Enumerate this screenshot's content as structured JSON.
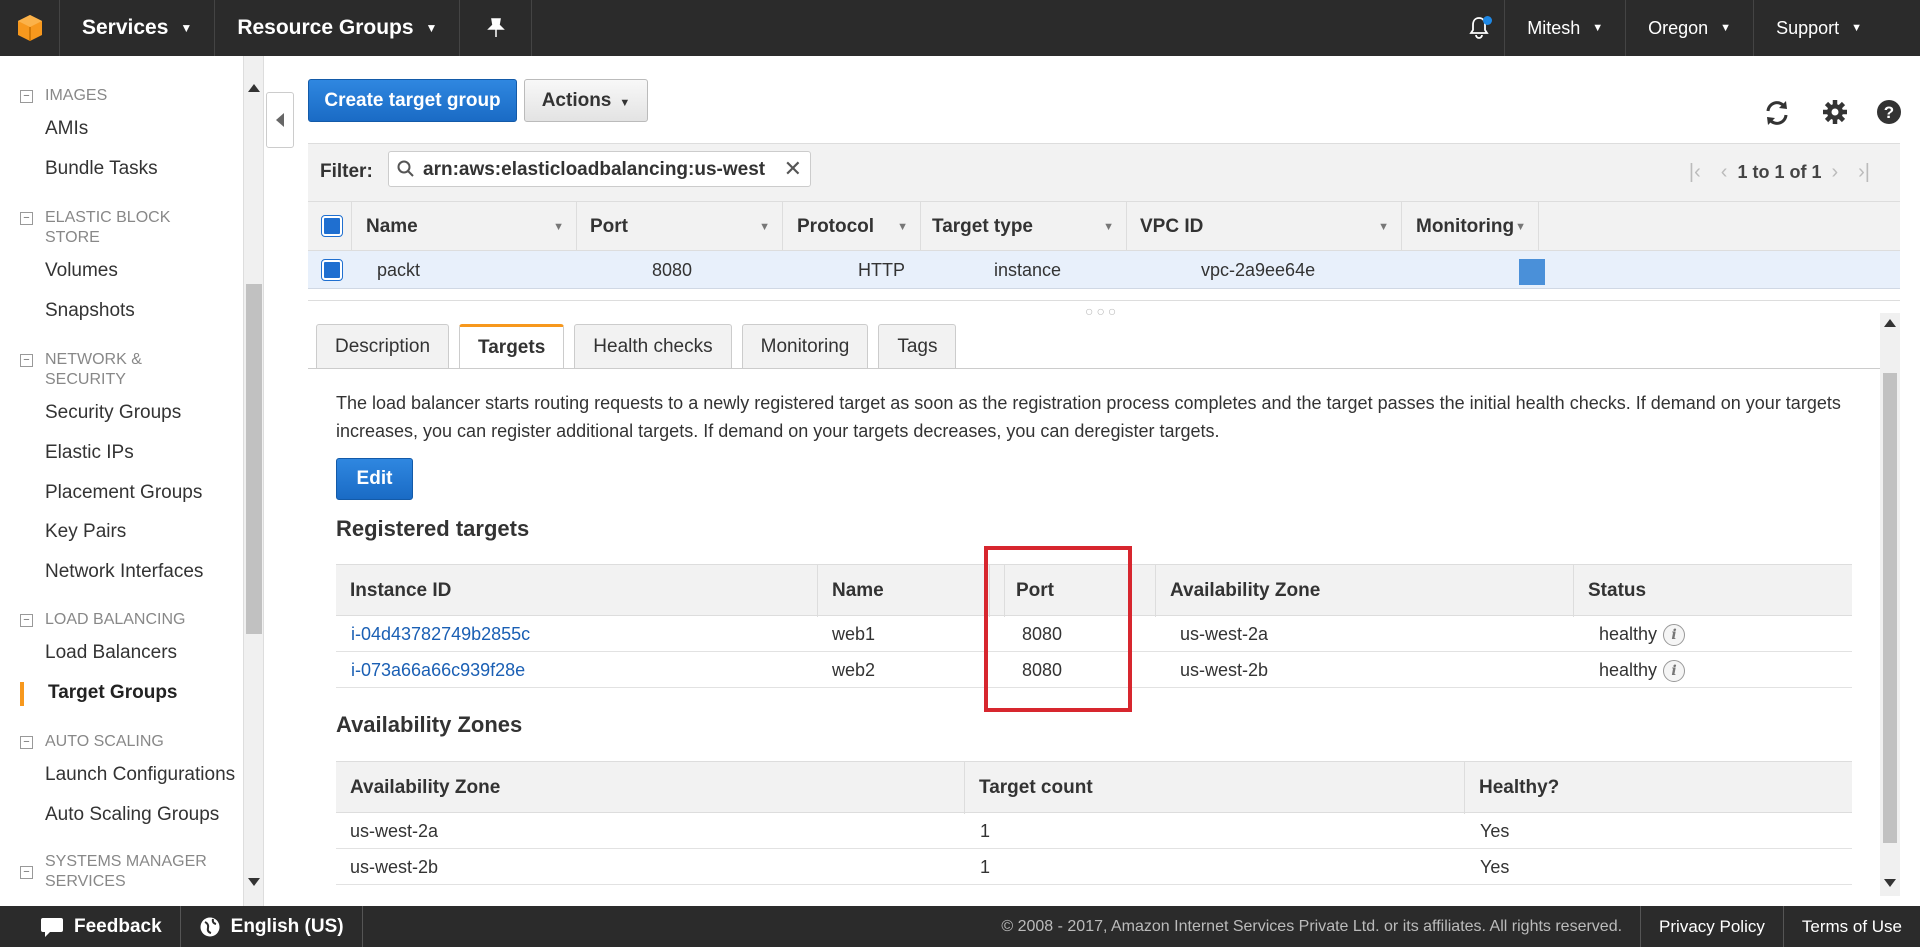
{
  "topnav": {
    "services_label": "Services",
    "resource_groups_label": "Resource Groups",
    "user_label": "Mitesh",
    "region_label": "Oregon",
    "support_label": "Support"
  },
  "sidebar": {
    "sections": [
      {
        "title": "IMAGES",
        "items": [
          "AMIs",
          "Bundle Tasks"
        ]
      },
      {
        "title": "ELASTIC BLOCK STORE",
        "items": [
          "Volumes",
          "Snapshots"
        ]
      },
      {
        "title": "NETWORK & SECURITY",
        "items": [
          "Security Groups",
          "Elastic IPs",
          "Placement Groups",
          "Key Pairs",
          "Network Interfaces"
        ]
      },
      {
        "title": "LOAD BALANCING",
        "items": [
          "Load Balancers",
          "Target Groups"
        ]
      },
      {
        "title": "AUTO SCALING",
        "items": [
          "Launch Configurations",
          "Auto Scaling Groups"
        ]
      },
      {
        "title": "SYSTEMS MANAGER SERVICES",
        "items": []
      }
    ],
    "active_item": "Target Groups"
  },
  "toolbar": {
    "create_label": "Create target group",
    "actions_label": "Actions"
  },
  "filter": {
    "label": "Filter:",
    "value": "arn:aws:elasticloadbalancing:us-west",
    "pager_text": "1 to 1 of 1"
  },
  "target_groups_table": {
    "columns": [
      "Name",
      "Port",
      "Protocol",
      "Target type",
      "VPC ID",
      "Monitoring"
    ],
    "rows": [
      {
        "name": "packt",
        "port": "8080",
        "protocol": "HTTP",
        "target_type": "instance",
        "vpc_id": "vpc-2a9ee64e"
      }
    ]
  },
  "tabs": [
    "Description",
    "Targets",
    "Health checks",
    "Monitoring",
    "Tags"
  ],
  "active_tab": "Targets",
  "targets": {
    "description": "The load balancer starts routing requests to a newly registered target as soon as the registration process completes and the target passes the initial health checks. If demand on your targets increases, you can register additional targets. If demand on your targets decreases, you can deregister targets.",
    "edit_label": "Edit",
    "registered_title": "Registered targets",
    "registered_columns": [
      "Instance ID",
      "Name",
      "Port",
      "Availability Zone",
      "Status"
    ],
    "registered_rows": [
      {
        "instance_id": "i-04d43782749b2855c",
        "name": "web1",
        "port": "8080",
        "zone": "us-west-2a",
        "status": "healthy"
      },
      {
        "instance_id": "i-073a66a66c939f28e",
        "name": "web2",
        "port": "8080",
        "zone": "us-west-2b",
        "status": "healthy"
      }
    ],
    "az_title": "Availability Zones",
    "az_columns": [
      "Availability Zone",
      "Target count",
      "Healthy?"
    ],
    "az_rows": [
      {
        "zone": "us-west-2a",
        "count": "1",
        "healthy": "Yes"
      },
      {
        "zone": "us-west-2b",
        "count": "1",
        "healthy": "Yes"
      }
    ]
  },
  "footer": {
    "feedback_label": "Feedback",
    "language_label": "English (US)",
    "copyright": "© 2008 - 2017, Amazon Internet Services Private Ltd. or its affiliates. All rights reserved.",
    "privacy_label": "Privacy Policy",
    "terms_label": "Terms of Use"
  },
  "colors": {
    "accent": "#f7981d",
    "primary_button": "#1a6bc5",
    "highlight": "#d7262e",
    "link": "#1a5fb4"
  }
}
